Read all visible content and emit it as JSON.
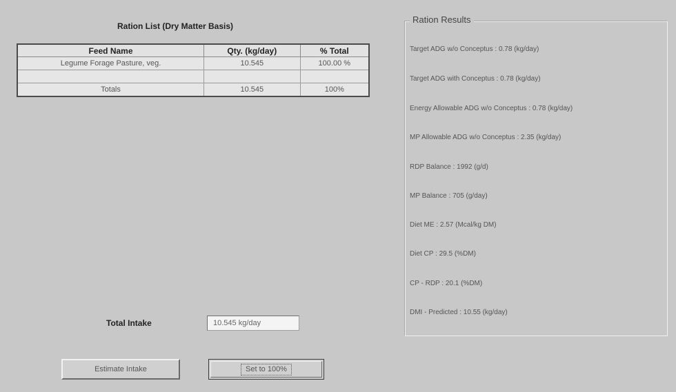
{
  "ration_list": {
    "title": "Ration List (Dry Matter Basis)",
    "columns": [
      "Feed Name",
      "Qty. (kg/day)",
      "% Total"
    ],
    "rows": [
      {
        "name": "Legume Forage Pasture, veg.",
        "qty": "10.545",
        "pct": "100.00 %"
      },
      {
        "name": "",
        "qty": "",
        "pct": ""
      },
      {
        "name": "Totals",
        "qty": "10.545",
        "pct": "100%"
      }
    ]
  },
  "total_intake": {
    "label": "Total Intake",
    "value": "10.545 kg/day"
  },
  "buttons": {
    "estimate_label": "Estimate Intake",
    "set100_label": "Set to 100%"
  },
  "results": {
    "title": "Ration Results",
    "lines": [
      "Target ADG w/o Conceptus : 0.78 (kg/day)",
      "Target ADG with Conceptus : 0.78 (kg/day)",
      "Energy Allowable ADG w/o Conceptus : 0.78 (kg/day)",
      "MP Allowable ADG w/o Conceptus : 2.35 (kg/day)",
      "RDP Balance : 1992 (g/d)",
      "MP Balance : 705 (g/day)",
      "Diet ME : 2.57 (Mcal/kg DM)",
      "Diet CP : 29.5 (%DM)",
      "CP - RDP : 20.1 (%DM)",
      "DMI - Predicted : 10.55 (kg/day)"
    ]
  }
}
